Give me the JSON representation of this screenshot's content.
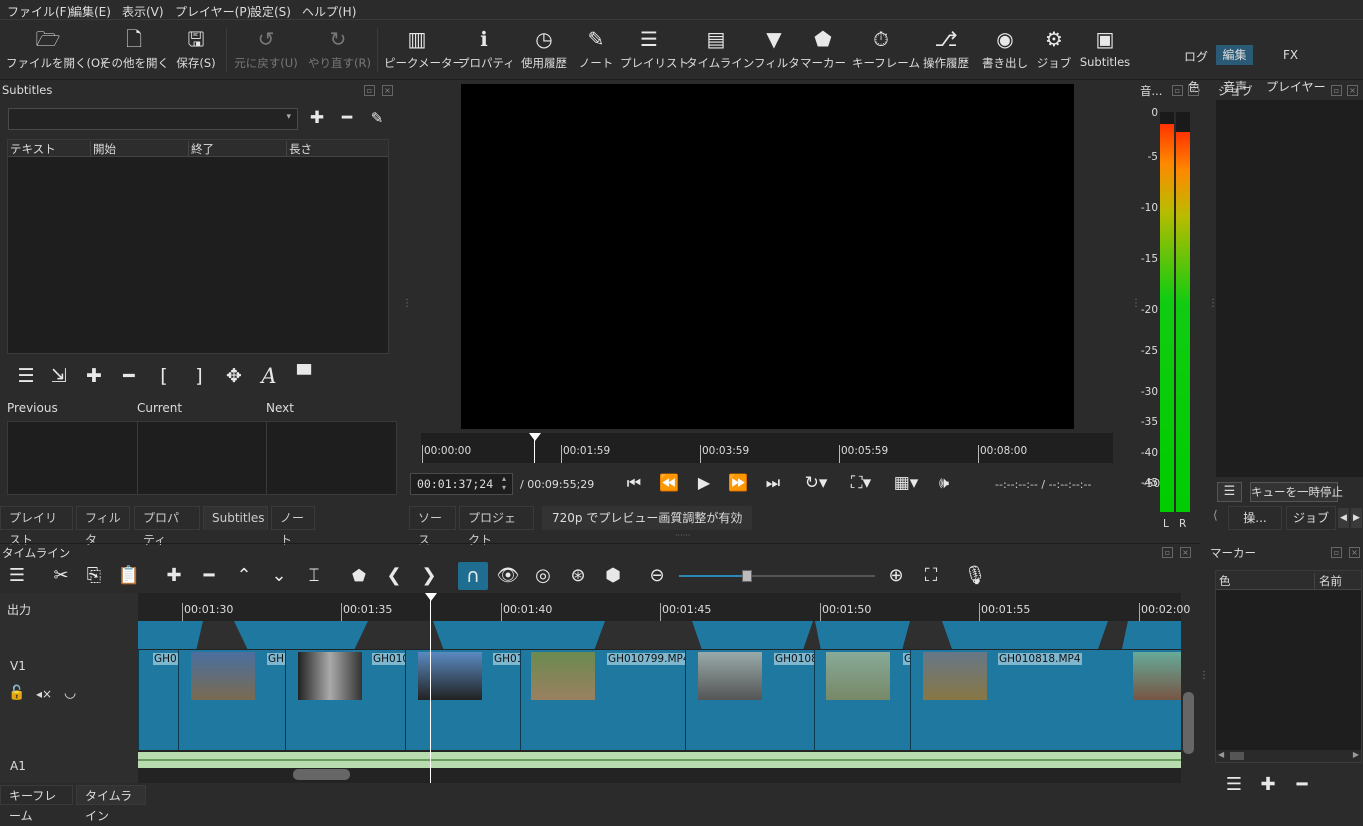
{
  "menu": [
    "ファイル(F)",
    "編集(E)",
    "表示(V)",
    "プレイヤー(P)",
    "設定(S)",
    "ヘルプ(H)"
  ],
  "toolbar": {
    "open_file": "ファイルを開く(O)",
    "open_other": "その他を開く",
    "save": "保存(S)",
    "undo": "元に戻す(U)",
    "redo": "やり直す(R)",
    "peak_meter": "ピークメーター",
    "properties": "プロパティ",
    "recent": "使用履歴",
    "notes": "ノート",
    "playlist": "プレイリスト",
    "timeline": "タイムライン",
    "filters": "フィルタ",
    "markers": "マーカー",
    "keyframes": "キーフレーム",
    "history": "操作履歴",
    "export": "書き出し",
    "jobs": "ジョブ",
    "subtitles": "Subtitles",
    "layout_top": [
      "ログ",
      "編集",
      "FX"
    ],
    "layout_bottom": [
      "色",
      "音声",
      "プレイヤー"
    ]
  },
  "subtitles_panel": {
    "title": "Subtitles",
    "columns": [
      "テキスト",
      "開始",
      "終了",
      "長さ"
    ],
    "previous": "Previous",
    "current": "Current",
    "next": "Next"
  },
  "left_tabs": [
    "プレイリスト",
    "フィルタ",
    "プロパティ",
    "Subtitles",
    "ノート"
  ],
  "player": {
    "ruler": [
      "00:00:00",
      "00:01:59",
      "00:03:59",
      "00:05:59",
      "00:08:00"
    ],
    "timecode": "00:01:37;24",
    "duration": "/ 00:09:55;29",
    "in_out": "--:--:--:-- / --:--:--:--",
    "tabs": [
      "ソース",
      "プロジェクト"
    ],
    "status": "720p でプレビュー画質調整が有効"
  },
  "audio_meter": {
    "title": "音...",
    "scale": [
      "0",
      "-5",
      "-10",
      "-15",
      "-20",
      "-25",
      "-30",
      "-35",
      "-40",
      "-45",
      "-50"
    ],
    "left": "L",
    "right": "R",
    "left_level": 0.97,
    "right_level": 0.95
  },
  "jobs_panel": {
    "title": "ジョブ",
    "pause_queue": "キューを一時停止",
    "tabs": [
      "操...",
      "ジョブ"
    ]
  },
  "timeline": {
    "title": "タイムライン",
    "output": "出力",
    "ruler": [
      "00:01:30",
      "00:01:35",
      "00:01:40",
      "00:01:45",
      "00:01:50",
      "00:01:55",
      "00:02:00"
    ],
    "tracks": [
      "V1",
      "A1"
    ],
    "clips": [
      "GH01",
      "GH",
      "GH010",
      "GH01",
      "GH010799.MP4",
      "GH0108",
      "G",
      "GH010818.MP4"
    ],
    "bottom_tabs": [
      "キーフレーム",
      "タイムライン"
    ]
  },
  "markers_panel": {
    "title": "マーカー",
    "columns": [
      "色",
      "名前"
    ]
  },
  "colors": {
    "accent": "#1f78a0",
    "selected_layout": "#2a5a75"
  }
}
